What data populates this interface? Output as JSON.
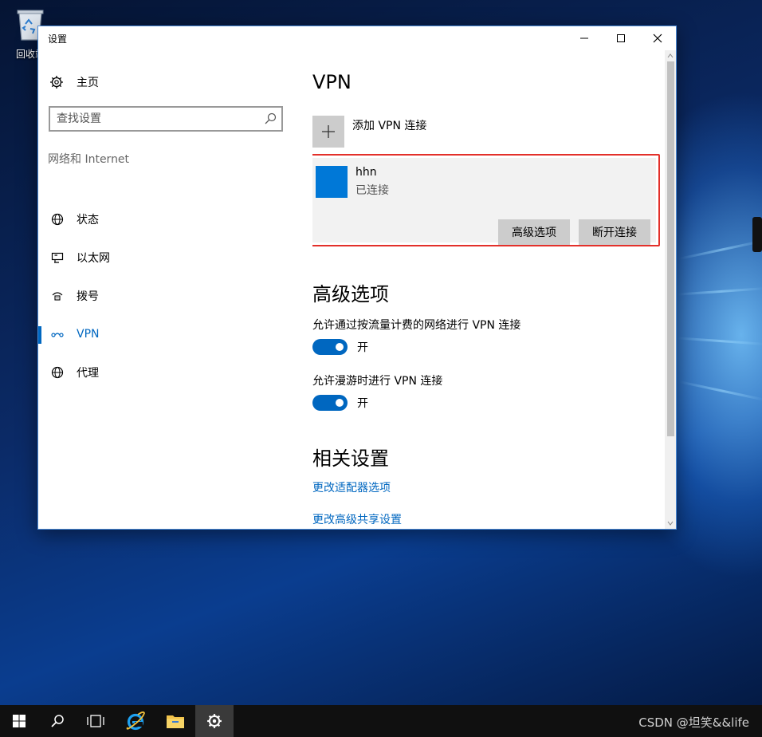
{
  "desktop": {
    "recycle_bin_label": "回收站"
  },
  "window": {
    "title": "设置",
    "controls": {
      "minimize": "—",
      "maximize": "☐",
      "close": "✕"
    }
  },
  "nav": {
    "home": "主页",
    "search_placeholder": "查找设置",
    "section": "网络和 Internet",
    "items": [
      {
        "label": "状态",
        "icon": "globe-status-icon"
      },
      {
        "label": "以太网",
        "icon": "ethernet-icon"
      },
      {
        "label": "拨号",
        "icon": "dialup-icon"
      },
      {
        "label": "VPN",
        "icon": "vpn-icon",
        "active": true
      },
      {
        "label": "代理",
        "icon": "globe-proxy-icon"
      }
    ]
  },
  "main": {
    "title": "VPN",
    "add_vpn_label": "添加 VPN 连接",
    "connection": {
      "name": "hhn",
      "status": "已连接",
      "advanced_button": "高级选项",
      "disconnect_button": "断开连接"
    },
    "advanced": {
      "heading": "高级选项",
      "options": [
        {
          "label": "允许通过按流量计费的网络进行 VPN 连接",
          "state": "开",
          "on": true
        },
        {
          "label": "允许漫游时进行 VPN 连接",
          "state": "开",
          "on": true
        }
      ]
    },
    "related": {
      "heading": "相关设置",
      "links": [
        "更改适配器选项",
        "更改高级共享设置"
      ]
    }
  },
  "taskbar": {
    "watermark": "CSDN @坦笑&&life"
  },
  "colors": {
    "accent": "#0067c0",
    "highlight_border": "#e3302a",
    "vpn_tile": "#0078d7"
  }
}
